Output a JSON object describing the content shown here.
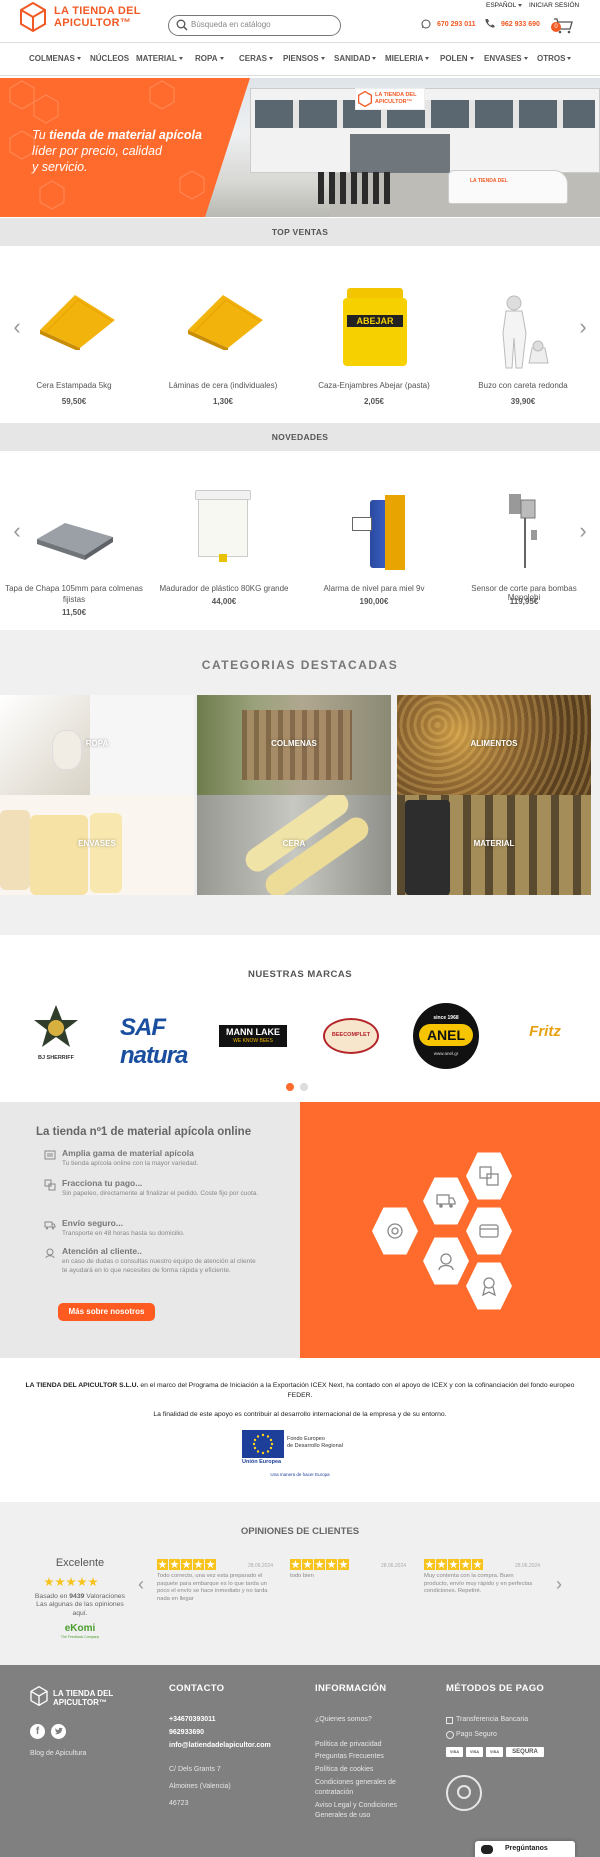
{
  "header": {
    "logo_line1": "LA TIENDA DEL",
    "logo_line2": "APICULTOR™",
    "search_placeholder": "Búsqueda en catálogo",
    "language": "ESPAÑOL",
    "login": "INICIAR SESIÓN",
    "whatsapp": "670 293 011",
    "phone": "962 933 690",
    "cart_count": "0"
  },
  "nav": [
    "COLMENAS",
    "NÚCLEOS",
    "MATERIAL",
    "ROPA",
    "CERAS",
    "PIENSOS",
    "SANIDAD",
    "MIELERIA",
    "POLEN",
    "ENVASES",
    "OTROS"
  ],
  "hero": {
    "line1_prefix": "Tu ",
    "line1_bold": "tienda de material apícola",
    "line2": "líder por precio, calidad",
    "line3": "y servicio.",
    "sign_line1": "LA TIENDA DEL",
    "sign_line2": "APICULTOR™"
  },
  "top_ventas": {
    "title": "TOP VENTAS",
    "products": [
      {
        "name": "Cera Estampada 5kg",
        "price": "59,50€"
      },
      {
        "name": "Láminas de cera (individuales)",
        "price": "1,30€"
      },
      {
        "name": "Caza-Enjambres Abejar (pasta)",
        "price": "2,05€",
        "label": "ABEJAR"
      },
      {
        "name": "Buzo con careta redonda",
        "price": "39,90€"
      }
    ]
  },
  "novedades": {
    "title": "NOVEDADES",
    "products": [
      {
        "name1": "Tapa de Chapa 105mm para colmenas",
        "name2": "fijistas",
        "price": "11,50€"
      },
      {
        "name1": "Madurador de plástico 80KG grande",
        "name2": "",
        "price": "44,00€"
      },
      {
        "name1": "Alarma de nivel para miel 9v",
        "name2": "",
        "price": "190,00€"
      },
      {
        "name1": "Sensor de corte para bombas Monolobi",
        "name2": "",
        "price": "119,95€"
      }
    ]
  },
  "categorias": {
    "title": "CATEGORIAS DESTACADAS",
    "items": [
      "ROPA",
      "COLMENAS",
      "ALIMENTOS",
      "ENVASES",
      "CERA",
      "MATERIAL"
    ]
  },
  "marcas": {
    "title": "NUESTRAS MARCAS",
    "brands": [
      "BJ SHERRIFF",
      "SAF natura",
      "MANN LAKE",
      "WE KNOW BEES",
      "BEECOMPLET",
      "ANEL",
      "since 1968",
      "www.anel.gr",
      "Fritz"
    ]
  },
  "about": {
    "title": "La tienda nº1 de material apícola online",
    "features": [
      {
        "title": "Amplia gama de material apícola",
        "desc": "Tu tienda apícola online con la mayor variedad."
      },
      {
        "title": "Fracciona tu pago...",
        "desc": "Sin papeleo, directamente al finalizar el pedido. Coste fijo por cuota."
      },
      {
        "title": "Envío seguro...",
        "desc": "Transporte en 48 horas hasta su domicilio."
      },
      {
        "title": "Atención al cliente..",
        "desc": "en caso de dudas o consultas nuestro equipo de atención al cliente te ayudará en lo que necesites de forma rápida y eficiente."
      }
    ],
    "button": "Más sobre nosotros"
  },
  "legal": {
    "company": "LA TIENDA DEL APICULTOR S.L.U.",
    "text1": " en el marco del Programa de Iniciación a la Exportación ICEX Next, ha contado con el apoyo de ICEX y con la cofinanciación del fondo europeo FEDER.",
    "text2": "La finalidad de este apoyo es contribuir al desarrollo internacional de la empresa y de su entorno.",
    "eu_fund1": "Fondo Europeo",
    "eu_fund2": "de Desarrollo Regional",
    "eu_name": "Unión Europea",
    "eu_motto": "Una manera de hacer Europa"
  },
  "reviews": {
    "title": "OPINIONES DE CLIENTES",
    "summary_title": "Excelente",
    "summary_prefix": "Basado en ",
    "summary_count": "9439",
    "summary_suffix": " Valoraciones",
    "summary_sub1": "Las algunas de las opiniones",
    "summary_sub2": "aquí.",
    "provider": "eKomi",
    "provider_sub": "The Feedback Company",
    "items": [
      {
        "date": "28.06.2024",
        "text": "Todo correcto, una vez esta preparado el paquete para embarque es lo que tarda un poco el envío se hace inmediato y no tarda nada en llegar"
      },
      {
        "date": "28.06.2024",
        "text": "todo bien"
      },
      {
        "date": "28.06.2024",
        "text": "Muy contenta con la compra. Buen producto, envío muy rápido y en perfectas condiciones. Repetiré."
      }
    ]
  },
  "footer": {
    "logo_line1": "LA TIENDA DEL",
    "logo_line2": "APICULTOR™",
    "blog": "Blog de Apicultura",
    "contact_title": "CONTACTO",
    "phone1": "+34670393011",
    "phone2": "962933690",
    "email": "info@latiendadelapicultor.com",
    "address1": "C/ Dels Grants 7",
    "address2": "Almoines (Valencia)",
    "address3": "46723",
    "info_title": "INFORMACIÓN",
    "info_links": [
      "¿Quienes somos?",
      "Política de privacidad",
      "Preguntas Frecuentes",
      "Política de cookies",
      "Condiciones generales de",
      "contratación",
      "Aviso Legal y Condiciones",
      "Generales de uso"
    ],
    "pay_title": "MÉTODOS DE PAGO",
    "pay1": "Transferencia Bancaria",
    "pay2": "Pago Seguro",
    "cards": [
      "VISA",
      "VISA",
      "VISA",
      "SEQURA"
    ],
    "chat": "Pregúntanos"
  },
  "colors": {
    "brand": "#f15a24",
    "orange": "#ff6b2c",
    "gray": "#808080",
    "star": "#f8c31d"
  }
}
